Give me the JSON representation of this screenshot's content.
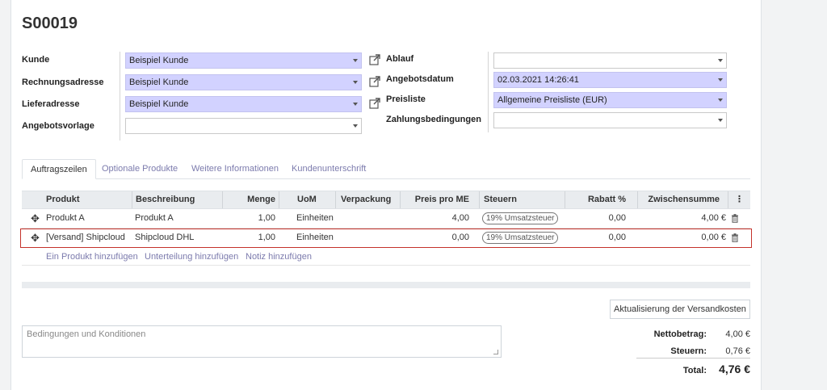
{
  "title": "S00019",
  "left_fields": [
    {
      "label": "Kunde",
      "value": "Beispiel Kunde"
    },
    {
      "label": "Rechnungsadresse",
      "value": "Beispiel Kunde"
    },
    {
      "label": "Lieferadresse",
      "value": "Beispiel Kunde"
    },
    {
      "label": "Angebotsvorlage",
      "value": ""
    }
  ],
  "right_fields": [
    {
      "label": "Ablauf",
      "value": ""
    },
    {
      "label": "Angebotsdatum",
      "value": "02.03.2021 14:26:41"
    },
    {
      "label": "Preisliste",
      "value": "Allgemeine Preisliste (EUR)"
    },
    {
      "label": "Zahlungsbedingungen",
      "value": ""
    }
  ],
  "tabs": [
    "Auftragszeilen",
    "Optionale Produkte",
    "Weitere Informationen",
    "Kundenunterschrift"
  ],
  "columns": {
    "produkt": "Produkt",
    "beschreibung": "Beschreibung",
    "menge": "Menge",
    "uom": "UoM",
    "verpackung": "Verpackung",
    "preis": "Preis pro ME",
    "steuern": "Steuern",
    "rabatt": "Rabatt %",
    "zwischensumme": "Zwischensumme"
  },
  "rows": [
    {
      "produkt": "Produkt A",
      "beschreibung": "Produkt A",
      "menge": "1,00",
      "uom": "Einheiten",
      "verpackung": "",
      "preis": "4,00",
      "steuern": "19% Umsatzsteuer",
      "rabatt": "0,00",
      "zwischensumme": "4,00 €"
    },
    {
      "produkt": "[Versand] Shipcloud",
      "beschreibung": "Shipcloud DHL",
      "menge": "1,00",
      "uom": "Einheiten",
      "verpackung": "",
      "preis": "0,00",
      "steuern": "19% Umsatzsteuer",
      "rabatt": "0,00",
      "zwischensumme": "0,00 €"
    }
  ],
  "add_links": {
    "product": "Ein Produkt hinzufügen",
    "section": "Unterteilung hinzufügen",
    "note": "Notiz hinzufügen"
  },
  "shipping_button": "Aktualisierung der Versandkosten",
  "terms_placeholder": "Bedingungen und Konditionen",
  "totals": {
    "net_label": "Nettobetrag:",
    "net_value": "4,00 €",
    "tax_label": "Steuern:",
    "tax_value": "0,76 €",
    "total_label": "Total:",
    "total_value": "4,76 €"
  },
  "colors": {
    "required_field": "#d2d2ff",
    "link": "#7c7bad",
    "highlight": "#c4322b"
  }
}
